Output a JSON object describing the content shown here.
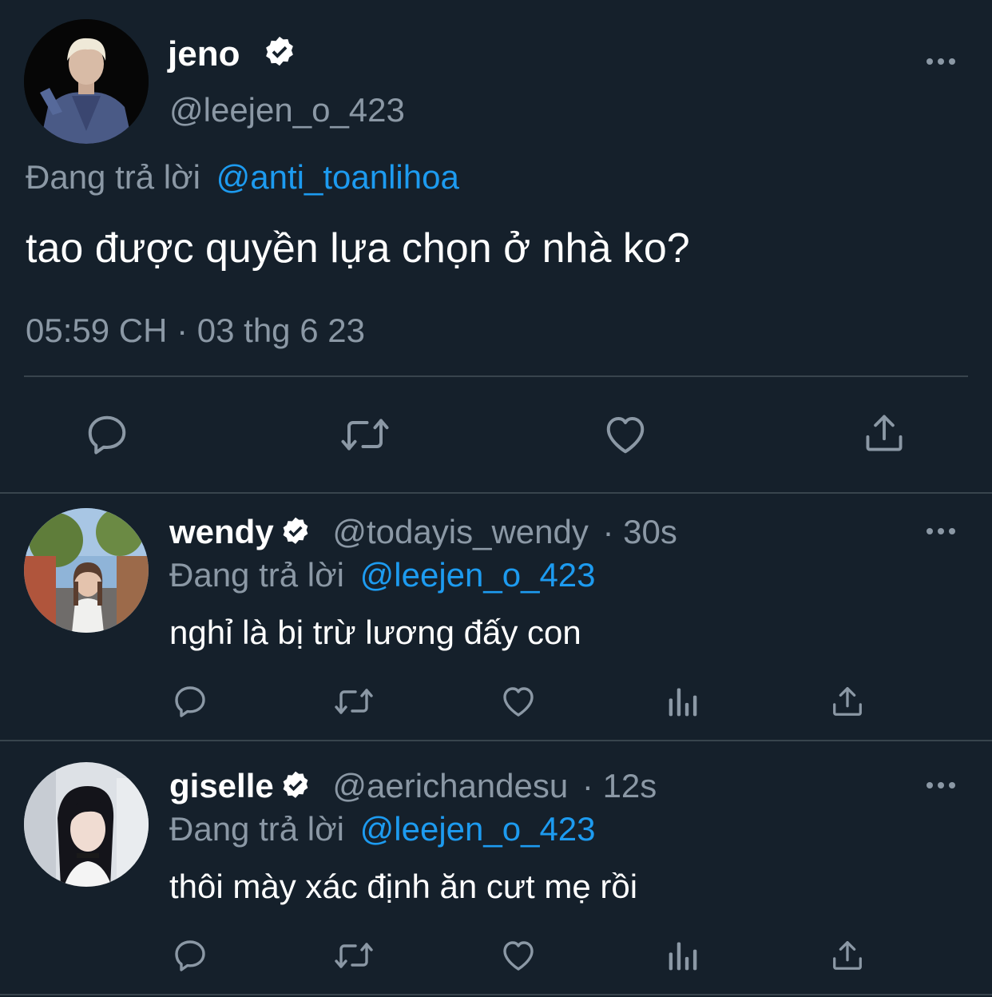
{
  "main_tweet": {
    "display_name": "jeno",
    "handle": "@leejen_o_423",
    "reply_prefix": "Đang trả lời",
    "reply_to": "@anti_toanlihoa",
    "text": "tao được quyền lựa chọn ở nhà ko?",
    "timestamp": "05:59 CH · 03 thg 6 23"
  },
  "replies": [
    {
      "display_name": "wendy",
      "handle": "@todayis_wendy",
      "time": "· 30s",
      "reply_prefix": "Đang trả lời",
      "reply_to": "@leejen_o_423",
      "text": "nghỉ là bị trừ lương đấy con"
    },
    {
      "display_name": "giselle",
      "handle": "@aerichandesu",
      "time": "· 12s",
      "reply_prefix": "Đang trả lời",
      "reply_to": "@leejen_o_423",
      "text": "thôi mày xác định ăn cưt mẹ rồi"
    }
  ],
  "colors": {
    "background": "#15202b",
    "muted": "#8b98a5",
    "link": "#1d9bf0",
    "divider": "#38444d"
  },
  "icons": [
    "more-icon",
    "verified-badge-icon",
    "reply-icon",
    "retweet-icon",
    "like-icon",
    "share-icon",
    "analytics-icon"
  ]
}
